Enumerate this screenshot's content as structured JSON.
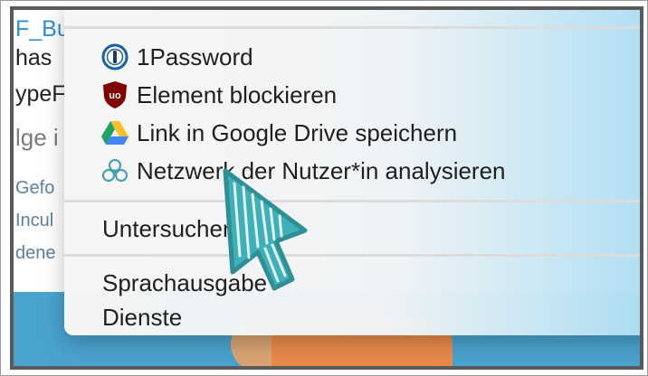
{
  "background_page": {
    "link_fragment": "F_Bu",
    "line2": "has",
    "line3": "ypeF",
    "heading": "lge i",
    "small_lines": [
      "Gefo",
      "Incul",
      "dene"
    ]
  },
  "context_menu": {
    "extension_items": [
      {
        "label": "1Password",
        "icon": "1password-icon"
      },
      {
        "label": "Element blockieren",
        "icon": "ublock-origin-icon"
      },
      {
        "label": "Link in Google Drive speichern",
        "icon": "google-drive-icon"
      },
      {
        "label": "Netzwerk der Nutzer*in analysieren",
        "icon": "network-analysis-icon"
      }
    ],
    "inspect_label": "Untersuchen",
    "speech_label": "Sprachausgabe",
    "services_label": "Dienste"
  },
  "colors": {
    "cursor": "#3fb0b9",
    "ublock_red": "#800000",
    "link_blue": "#2f8fd6"
  }
}
